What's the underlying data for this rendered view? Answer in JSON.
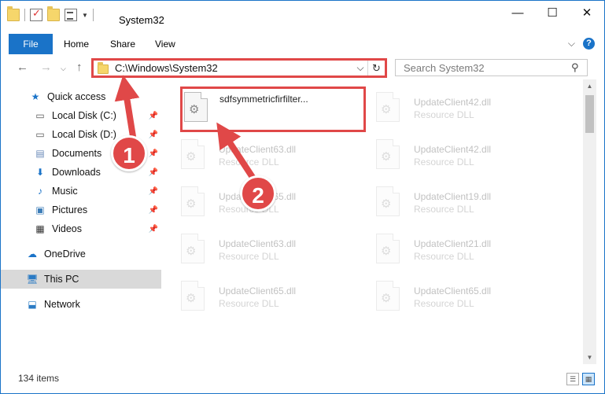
{
  "window": {
    "title": "System32",
    "controls": {
      "minimize": "—",
      "maximize": "☐",
      "close": "✕"
    }
  },
  "ribbon": {
    "tabs": [
      "File",
      "Home",
      "Share",
      "View"
    ],
    "expand_glyph": "⌵",
    "help_glyph": "?"
  },
  "address_bar": {
    "path": "C:\\Windows\\System32",
    "search_placeholder": "Search System32"
  },
  "sidebar": {
    "items": [
      {
        "label": "Quick access",
        "icon": "star-icon",
        "pinned": false
      },
      {
        "label": "Local Disk (C:)",
        "icon": "drive-icon",
        "pinned": true
      },
      {
        "label": "Local Disk (D:)",
        "icon": "drive-icon",
        "pinned": true
      },
      {
        "label": "Documents",
        "icon": "documents-icon",
        "pinned": true
      },
      {
        "label": "Downloads",
        "icon": "download-icon",
        "pinned": true
      },
      {
        "label": "Music",
        "icon": "music-icon",
        "pinned": true
      },
      {
        "label": "Pictures",
        "icon": "pictures-icon",
        "pinned": true
      },
      {
        "label": "Videos",
        "icon": "videos-icon",
        "pinned": true
      },
      {
        "label": "OneDrive",
        "icon": "cloud-icon",
        "pinned": false
      },
      {
        "label": "This PC",
        "icon": "computer-icon",
        "pinned": false,
        "selected": true
      },
      {
        "label": "Network",
        "icon": "network-icon",
        "pinned": false
      }
    ]
  },
  "files": [
    {
      "name": "sdfsymmetricfirfilter...",
      "type": "",
      "highlighted": true
    },
    {
      "name": "UpdateClient42.dll",
      "type": "Resource DLL"
    },
    {
      "name": "UpdateClient63.dll",
      "type": "Resource DLL"
    },
    {
      "name": "UpdateClient42.dll",
      "type": "Resource DLL"
    },
    {
      "name": "UpdateClient65.dll",
      "type": "Resource DLL"
    },
    {
      "name": "UpdateClient19.dll",
      "type": "Resource DLL"
    },
    {
      "name": "UpdateClient63.dll",
      "type": "Resource DLL"
    },
    {
      "name": "UpdateClient21.dll",
      "type": "Resource DLL"
    },
    {
      "name": "UpdateClient65.dll",
      "type": "Resource DLL"
    },
    {
      "name": "UpdateClient65.dll",
      "type": "Resource DLL"
    }
  ],
  "status": {
    "item_count": "134 items"
  },
  "callouts": [
    {
      "number": "1"
    },
    {
      "number": "2"
    }
  ],
  "colors": {
    "accent": "#1a73c8",
    "callout": "#e04848",
    "selected_bg": "#d9d9d9"
  }
}
